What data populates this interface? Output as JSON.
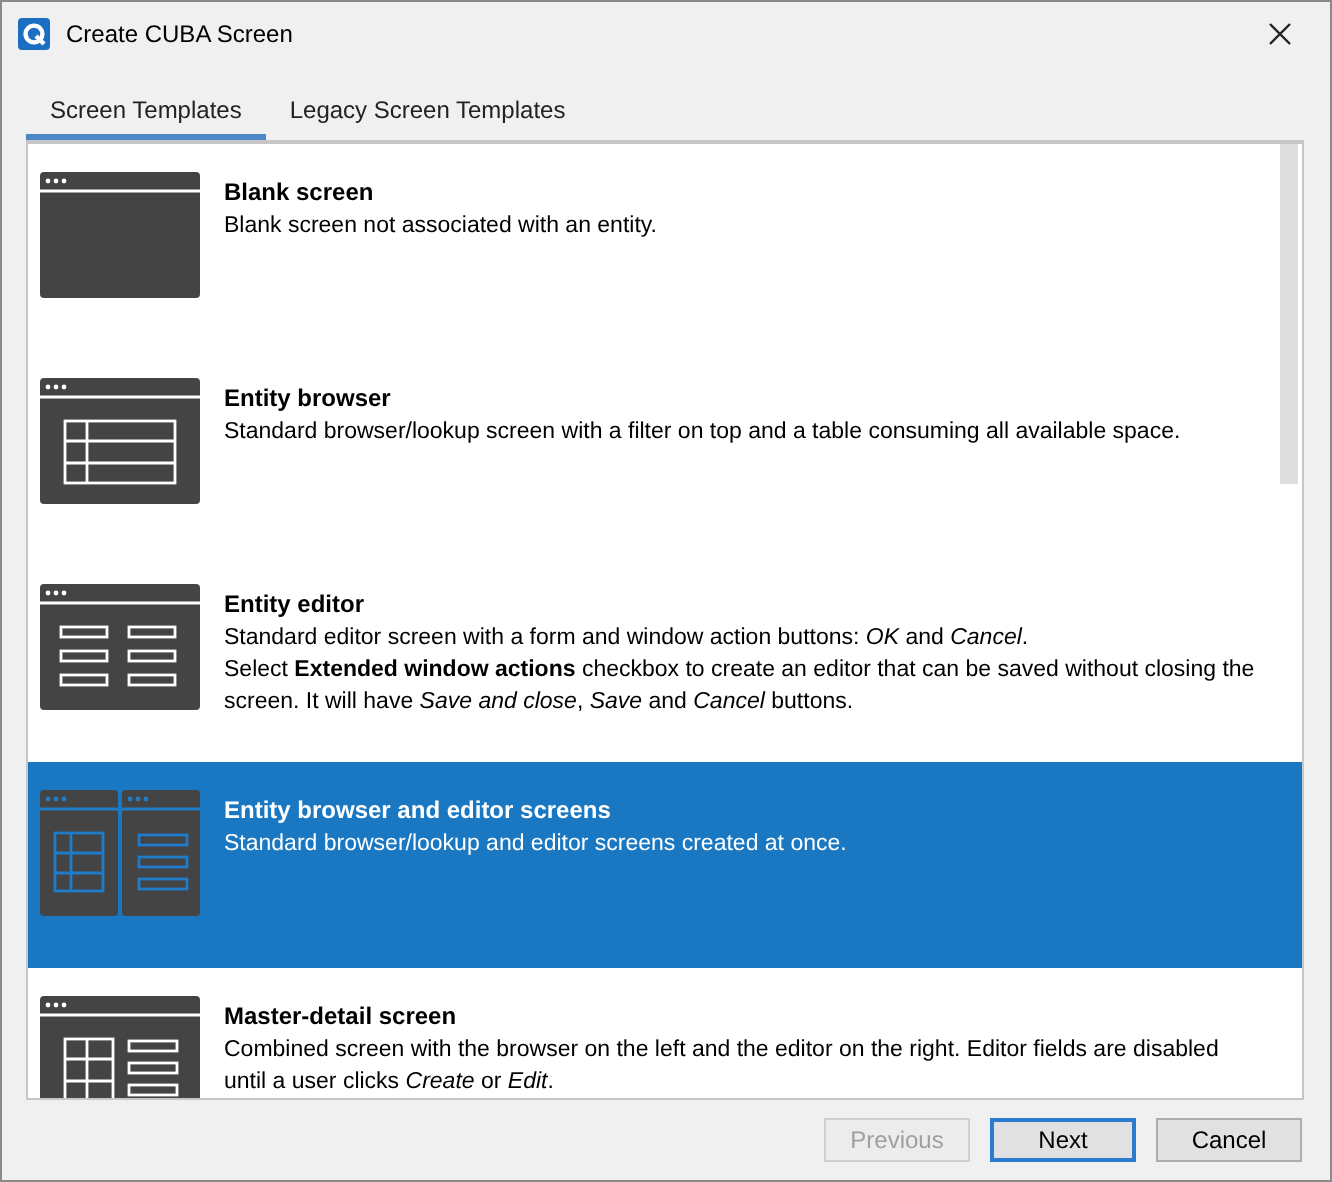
{
  "window": {
    "title": "Create CUBA Screen"
  },
  "tabs": [
    {
      "label": "Screen Templates",
      "selected": true
    },
    {
      "label": "Legacy Screen Templates",
      "selected": false
    }
  ],
  "templates": [
    {
      "kind": "blank",
      "title": "Blank screen",
      "description": [
        "Blank screen not associated with an entity."
      ],
      "selected": false
    },
    {
      "kind": "browser",
      "title": "Entity browser",
      "description": [
        "Standard browser/lookup screen with a filter on top and a table consuming all available space."
      ],
      "selected": false
    },
    {
      "kind": "editor",
      "title": "Entity editor",
      "description": [
        "Standard editor screen with a form and window action buttons: *OK* and *Cancel*.",
        "Select **Extended window actions** checkbox to create an editor that can be saved without closing the screen. It will have *Save and close*, *Save* and *Cancel* buttons."
      ],
      "selected": false
    },
    {
      "kind": "browser-editor",
      "title": "Entity browser and editor screens",
      "description": [
        "Standard browser/lookup and editor screens created at once."
      ],
      "selected": true
    },
    {
      "kind": "master-detail",
      "title": "Master-detail screen",
      "description": [
        "Combined screen with the browser on the left and the editor on the right. Editor fields are disabled until a user clicks *Create* or *Edit*."
      ],
      "selected": false
    }
  ],
  "buttons": [
    {
      "label": "Previous",
      "disabled": true,
      "default": false
    },
    {
      "label": "Next",
      "disabled": false,
      "default": true
    },
    {
      "label": "Cancel",
      "disabled": false,
      "default": false
    }
  ]
}
